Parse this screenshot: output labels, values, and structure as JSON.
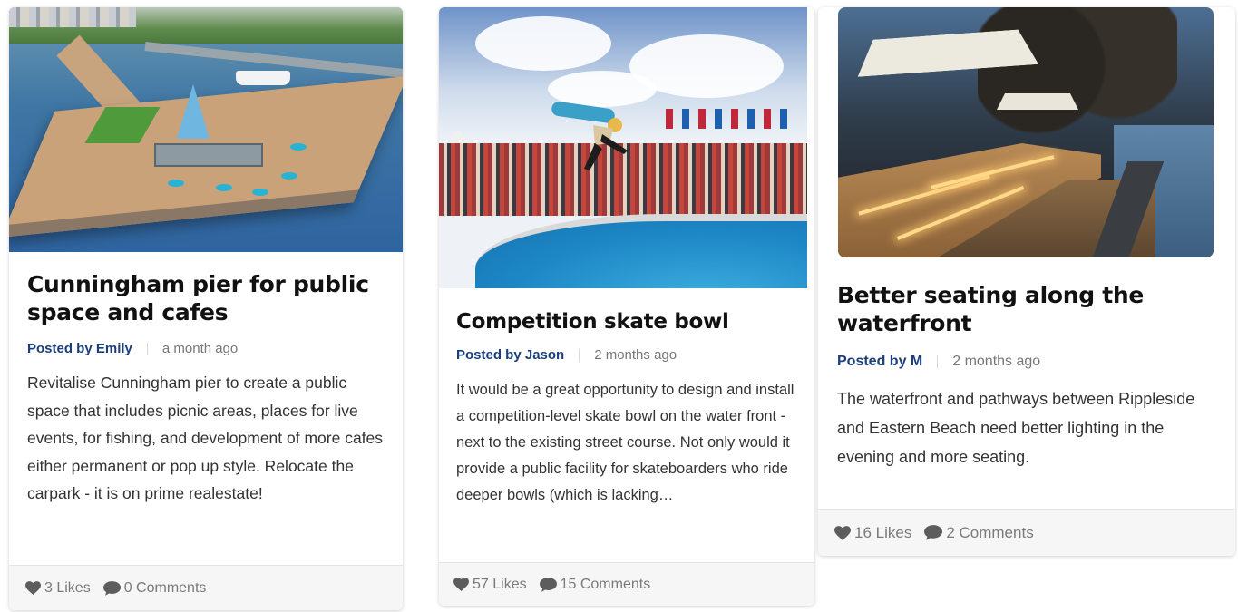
{
  "colors": {
    "author": "#1a3f7a",
    "title": "#111111",
    "meta_time": "#777777",
    "footer_bg": "#f6f6f6"
  },
  "cards": [
    {
      "image_alt": "Cunningham pier aerial render",
      "title": "Cunningham pier for public space and cafes",
      "author": "Posted by Emily",
      "time": "a month ago",
      "excerpt": "Revitalise Cunningham pier to create a public space that includes picnic areas, places for live events, for fishing, and development of more cafes either permanent or pop up style. Relocate the carpark - it is on prime realestate!",
      "likes": "3 Likes",
      "comments": "0 Comments"
    },
    {
      "image_alt": "Skateboarder in competition bowl",
      "title": "Competition skate bowl",
      "author": "Posted by Jason",
      "time": "2 months ago",
      "excerpt": "It would be a great opportunity to design and install a competition-level skate bowl on the water front - next to the existing street course. Not only would it provide a public facility for skateboarders who ride deeper bowls (which is lacking…",
      "likes": "57 Likes",
      "comments": "15 Comments"
    },
    {
      "image_alt": "Lit waterfront seating at night",
      "title": "Better seating along the waterfront",
      "author": "Posted by M",
      "time": "2 months ago",
      "excerpt": "The waterfront and pathways between Rippleside and Eastern Beach need better lighting in the evening and more seating.",
      "likes": "16 Likes",
      "comments": "2 Comments"
    }
  ],
  "icons": {
    "like": "heart-icon",
    "comment": "speech-bubble-icon"
  }
}
